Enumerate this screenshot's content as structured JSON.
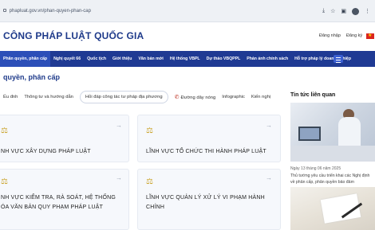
{
  "browser": {
    "url": "phapluat.gov.vn/phan-quyen-phan-cap"
  },
  "header": {
    "site_title": "CÔNG PHÁP LUẬT QUỐC GIA",
    "login": "Đăng nhập",
    "signup": "Đăng ký"
  },
  "nav": {
    "items": [
      {
        "label": "Phân quyền, phân cấp"
      },
      {
        "label": "Nghị quyết 66"
      },
      {
        "label": "Quốc tịch"
      },
      {
        "label": "Giới thiệu"
      },
      {
        "label": "Văn bản mới"
      },
      {
        "label": "Hệ thống VBPL"
      },
      {
        "label": "Dự thảo VBQPPL"
      },
      {
        "label": "Phản ánh chính sách"
      },
      {
        "label": "Hỗ trợ pháp lý doanh nghiệp"
      }
    ]
  },
  "page": {
    "heading": "quyền, phân cấp",
    "tabs": [
      {
        "label": "Ểu đnh"
      },
      {
        "label": "Thông tư và hướng dẫn"
      },
      {
        "label": "Hỏi đáp công tác tư pháp địa phương"
      },
      {
        "label": "Đường dây nóng"
      },
      {
        "label": "Infographic"
      },
      {
        "label": "Kiến nghị"
      }
    ]
  },
  "cards": [
    {
      "line1": "NH VỰC XÂY DỰNG PHÁP LUẬT",
      "line2": ""
    },
    {
      "line1": "LĨNH VỰC TỔ CHỨC THI HÀNH PHÁP LUẬT",
      "line2": ""
    },
    {
      "line1": "NH VỰC KIỂM TRA, RÀ SOÁT, HỆ THỐNG",
      "line2": "ÓA VĂN BẢN QUY PHẠM PHÁP LUẬT"
    },
    {
      "line1": "LĨNH VỰC QUẢN LÝ XỬ LÝ VI PHẠM HÀNH",
      "line2": "CHÍNH"
    }
  ],
  "sidebar": {
    "title": "Tin tức liên quan",
    "date": "Ngày 13 tháng 06 năm 2025",
    "news": "Thủ tướng yêu cầu triển khai các Nghị định về phân cấp, phân quyền bảo đảm"
  }
}
